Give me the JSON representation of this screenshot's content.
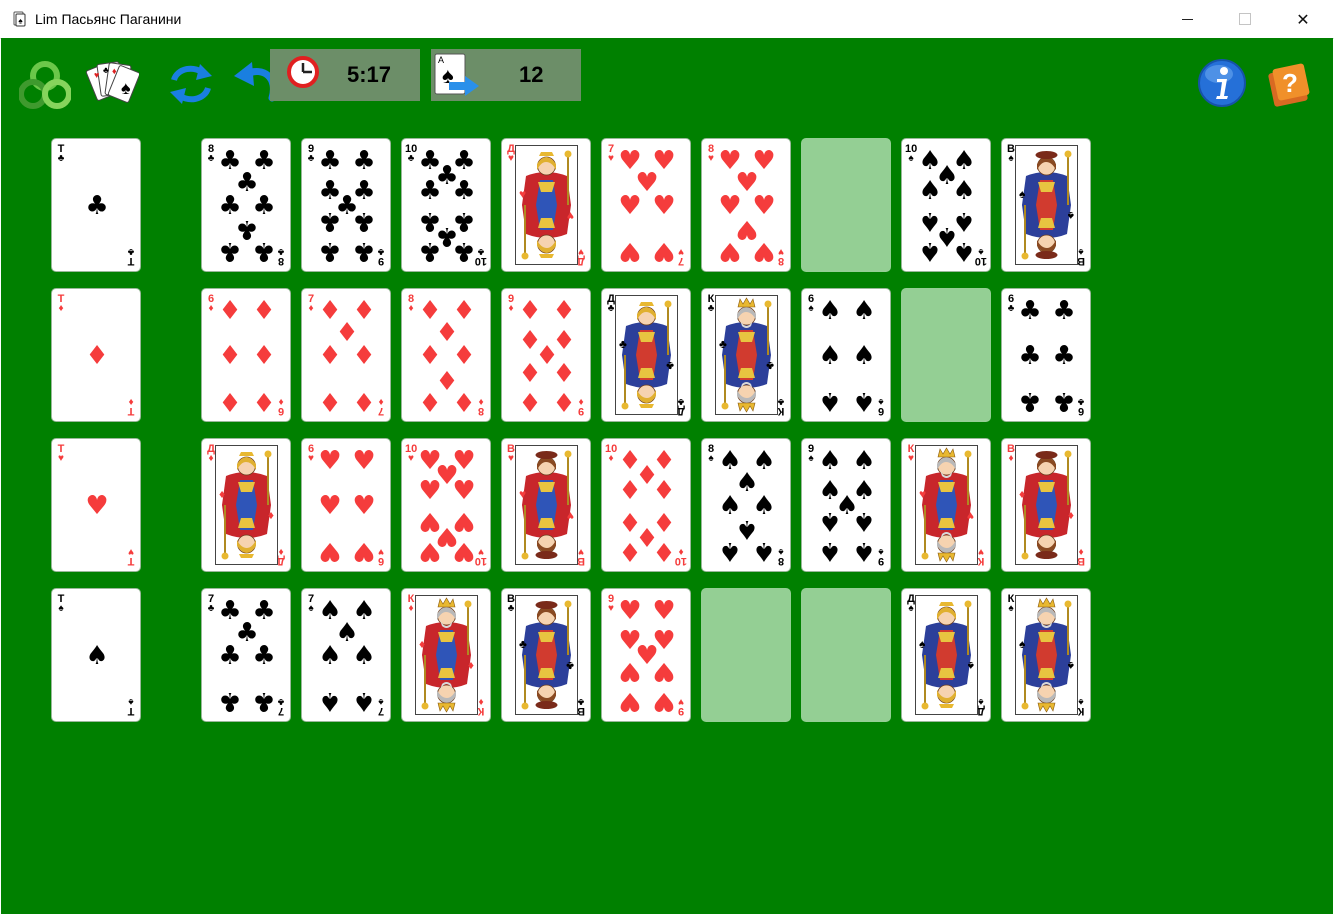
{
  "window": {
    "title": "Lim Пасьянс Паганини",
    "minimize_label": "",
    "maximize_label": "",
    "close_label": "✕"
  },
  "toolbar": {
    "buttons": [
      {
        "name": "new-game-button",
        "icon": "trefoil-logo-icon"
      },
      {
        "name": "deck-button",
        "icon": "card-fan-icon"
      },
      {
        "name": "restart-button",
        "icon": "refresh-arrows-icon"
      },
      {
        "name": "undo-button",
        "icon": "undo-arrow-icon"
      },
      {
        "name": "info-button",
        "icon": "info-icon"
      },
      {
        "name": "help-button",
        "icon": "help-book-icon"
      }
    ],
    "timer_value": "5:17",
    "moves_value": "12",
    "moves_icon_letter": "A"
  },
  "colors": {
    "table": "#008000",
    "empty_slot": "#94cf94",
    "red_suit": "#f53c3c",
    "counter_bg": "#6c8e68"
  },
  "board": {
    "aces": [
      {
        "rank": "Т",
        "suit": "♣"
      },
      {
        "rank": "Т",
        "suit": "♦"
      },
      {
        "rank": "Т",
        "suit": "♥"
      },
      {
        "rank": "Т",
        "suit": "♠"
      }
    ],
    "rows": [
      [
        {
          "rank": "8",
          "suit": "♣"
        },
        {
          "rank": "9",
          "suit": "♣"
        },
        {
          "rank": "10",
          "suit": "♣"
        },
        {
          "rank": "Д",
          "suit": "♥"
        },
        {
          "rank": "7",
          "suit": "♥"
        },
        {
          "rank": "8",
          "suit": "♥"
        },
        null,
        {
          "rank": "10",
          "suit": "♠"
        },
        {
          "rank": "В",
          "suit": "♠"
        }
      ],
      [
        {
          "rank": "6",
          "suit": "♦"
        },
        {
          "rank": "7",
          "suit": "♦"
        },
        {
          "rank": "8",
          "suit": "♦"
        },
        {
          "rank": "9",
          "suit": "♦"
        },
        {
          "rank": "Д",
          "suit": "♣"
        },
        {
          "rank": "К",
          "suit": "♣"
        },
        {
          "rank": "6",
          "suit": "♠"
        },
        null,
        {
          "rank": "6",
          "suit": "♣"
        }
      ],
      [
        {
          "rank": "Д",
          "suit": "♦"
        },
        {
          "rank": "6",
          "suit": "♥"
        },
        {
          "rank": "10",
          "suit": "♥"
        },
        {
          "rank": "В",
          "suit": "♥"
        },
        {
          "rank": "10",
          "suit": "♦"
        },
        {
          "rank": "8",
          "suit": "♠"
        },
        {
          "rank": "9",
          "suit": "♠"
        },
        {
          "rank": "К",
          "suit": "♥"
        },
        {
          "rank": "В",
          "suit": "♦"
        }
      ],
      [
        {
          "rank": "7",
          "suit": "♣"
        },
        {
          "rank": "7",
          "suit": "♠"
        },
        {
          "rank": "К",
          "suit": "♦"
        },
        {
          "rank": "В",
          "suit": "♣"
        },
        {
          "rank": "9",
          "suit": "♥"
        },
        null,
        null,
        {
          "rank": "Д",
          "suit": "♠"
        },
        {
          "rank": "К",
          "suit": "♠"
        }
      ]
    ]
  }
}
